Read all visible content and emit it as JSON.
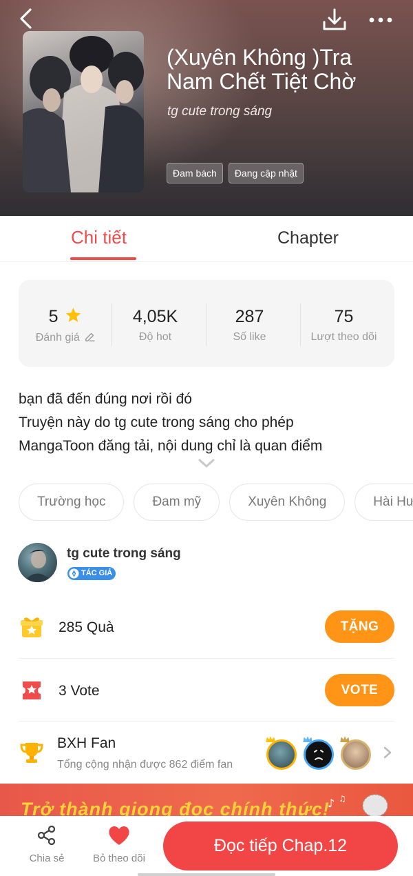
{
  "header": {
    "title": "(Xuyên Không )Tra Nam Chết Tiệt Chờ",
    "author": "tg cute trong sáng",
    "tags": [
      "Đam bách",
      "Đang cập nhật"
    ],
    "icons": {
      "back": "back-arrow-icon",
      "download": "download-icon",
      "more": "more-dots-icon"
    }
  },
  "tabs": [
    {
      "label": "Chi tiết",
      "active": true
    },
    {
      "label": "Chapter",
      "active": false
    }
  ],
  "stats": [
    {
      "value": "5",
      "label": "Đánh giá"
    },
    {
      "value": "4,05K",
      "label": "Độ hot"
    },
    {
      "value": "287",
      "label": "Số like"
    },
    {
      "value": "75",
      "label": "Lượt theo dõi"
    }
  ],
  "description": {
    "lines": [
      "bạn đã đến đúng nơi rồi đó",
      "Truyện này do tg cute trong sáng cho phép",
      "MangaToon đăng tải, nội dung chỉ là quan điểm"
    ]
  },
  "genres": [
    "Trường học",
    "Đam mỹ",
    "Xuyên Không",
    "Hài Hước"
  ],
  "author_card": {
    "name": "tg cute trong sáng",
    "badge": "TÁC GIẢ"
  },
  "gifts": {
    "text": "285 Quà",
    "button": "TẶNG"
  },
  "votes": {
    "text": "3 Vote",
    "button": "VOTE"
  },
  "fan_rank": {
    "title": "BXH Fan",
    "subtitle": "Tổng cộng nhận được 862 điểm fan"
  },
  "banner": {
    "text": "Trở thành giọng đọc chính thức!"
  },
  "bottom_bar": {
    "share_label": "Chia sẻ",
    "unfollow_label": "Bỏ theo dõi",
    "read_button": "Đọc tiếp Chap.12"
  },
  "colors": {
    "accent_red": "#ef4b4b",
    "orange_button": "#ff9416",
    "read_button": "#f24646",
    "star": "#ffc107"
  }
}
